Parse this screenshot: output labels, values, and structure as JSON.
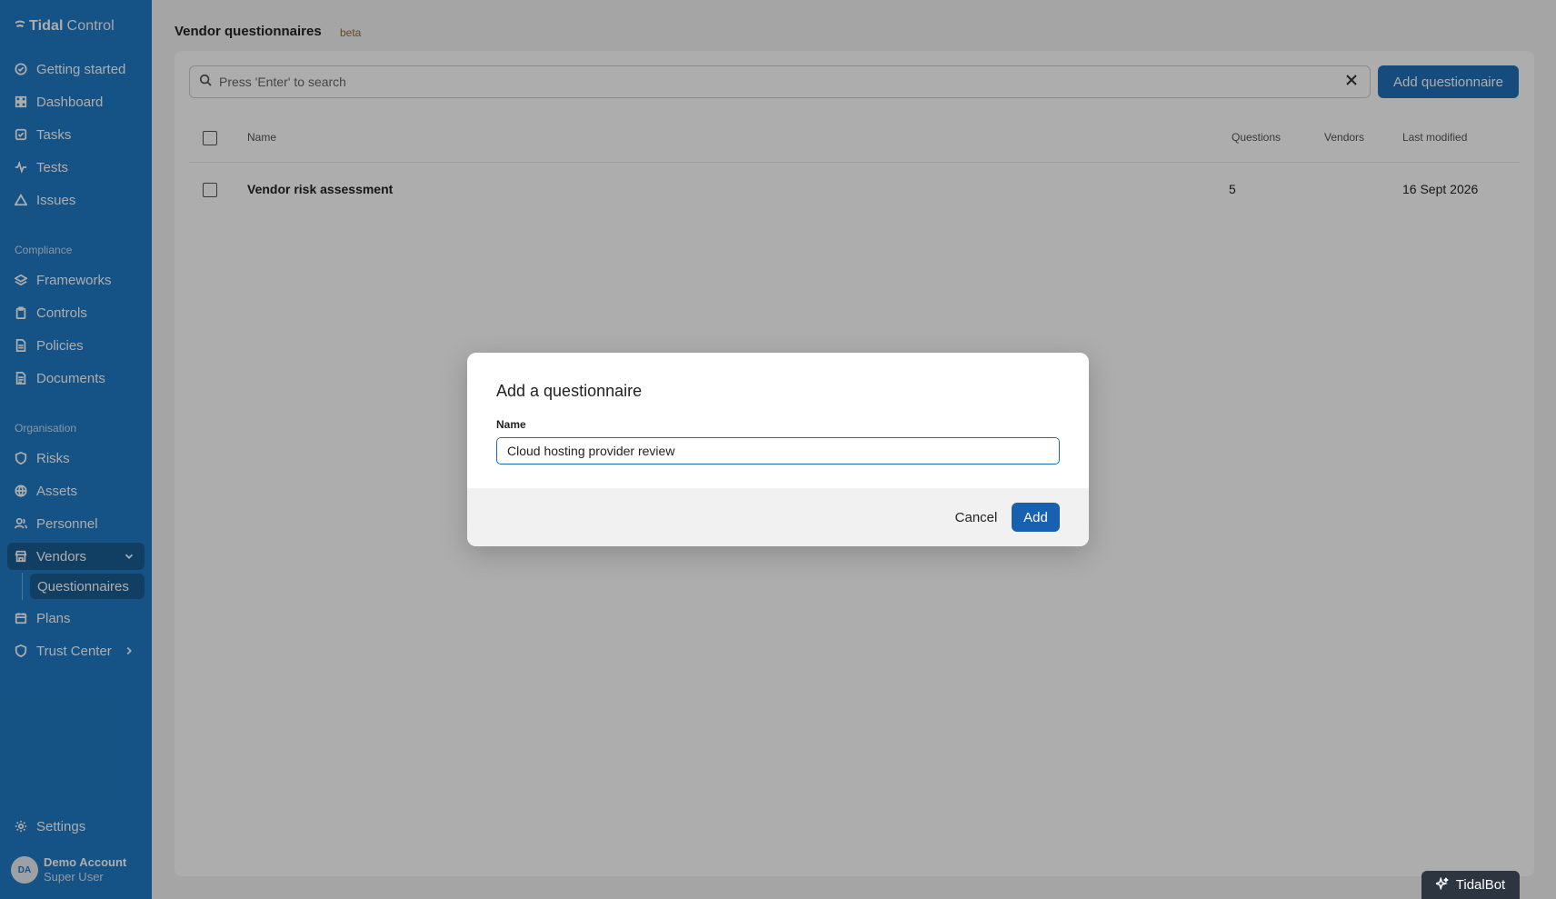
{
  "brand": {
    "part1": "Tidal",
    "part2": "Control"
  },
  "sidebar": {
    "items": [
      {
        "label": "Getting started",
        "icon": "check-circle-icon"
      },
      {
        "label": "Dashboard",
        "icon": "grid-icon"
      },
      {
        "label": "Tasks",
        "icon": "check-square-icon"
      },
      {
        "label": "Tests",
        "icon": "activity-icon"
      },
      {
        "label": "Issues",
        "icon": "warning-triangle-icon"
      }
    ],
    "compliance_label": "Compliance",
    "compliance_items": [
      {
        "label": "Frameworks",
        "icon": "layers-icon"
      },
      {
        "label": "Controls",
        "icon": "clipboard-icon"
      },
      {
        "label": "Policies",
        "icon": "document-icon"
      },
      {
        "label": "Documents",
        "icon": "file-icon"
      }
    ],
    "organisation_label": "Organisation",
    "organisation_items": [
      {
        "label": "Risks",
        "icon": "shield-alert-icon"
      },
      {
        "label": "Assets",
        "icon": "globe-icon"
      },
      {
        "label": "Personnel",
        "icon": "users-icon"
      },
      {
        "label": "Vendors",
        "icon": "store-icon",
        "active": true
      },
      {
        "label": "Questionnaires",
        "sub": true
      },
      {
        "label": "Plans",
        "icon": "calendar-icon"
      },
      {
        "label": "Trust Center",
        "icon": "shield-icon"
      }
    ],
    "settings_label": "Settings",
    "user": {
      "initials": "DA",
      "name": "Demo Account",
      "role": "Super User"
    }
  },
  "header": {
    "title": "Vendor questionnaires",
    "badge": "beta"
  },
  "toolbar": {
    "search_placeholder": "Press 'Enter' to search",
    "add_label": "Add questionnaire"
  },
  "table": {
    "columns": [
      "Name",
      "Questions",
      "Vendors",
      "Last modified"
    ],
    "rows": [
      {
        "name": "Vendor risk assessment",
        "questions": "5",
        "vendors": "",
        "last_modified": "16 Sept 2026"
      }
    ]
  },
  "modal": {
    "title": "Add a questionnaire",
    "field_label": "Name",
    "field_value": "Cloud hosting provider review",
    "cancel_label": "Cancel",
    "add_label": "Add"
  },
  "floating": {
    "tidalbot_label": "TidalBot"
  },
  "colors": {
    "sidebar": "#1f7ac4",
    "primary": "#1f6fb8",
    "overlay": "rgba(0,0,0,0.32)"
  }
}
